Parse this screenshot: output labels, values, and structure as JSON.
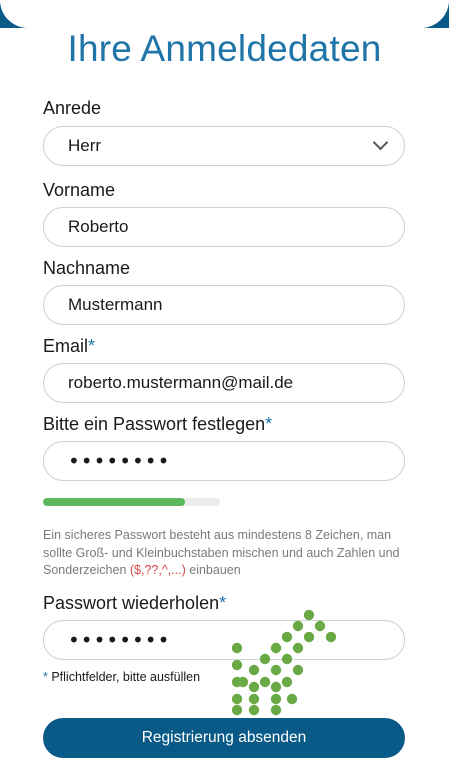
{
  "title": "Ihre Anmeldedaten",
  "salutation": {
    "label": "Anrede",
    "value": "Herr"
  },
  "first_name": {
    "label": "Vorname",
    "value": "Roberto"
  },
  "last_name": {
    "label": "Nachname",
    "value": "Mustermann"
  },
  "email": {
    "label": "Email",
    "required_mark": "*",
    "value": "roberto.mustermann@mail.de"
  },
  "password": {
    "label": "Bitte ein Passwort festlegen",
    "required_mark": "*",
    "value": "••••••••"
  },
  "password_strength": {
    "percent": 80,
    "color": "#5cb85c"
  },
  "hint": {
    "text_before": "Ein sicheres Passwort besteht aus mindestens 8 Zeichen, man sollte Groß- und Kleinbuchstaben mischen und auch Zahlen und Sonderzeichen ",
    "special_chars": "($,??,^,...)",
    "text_after": " einbauen"
  },
  "password_repeat": {
    "label": "Passwort wiederholen",
    "required_mark": "*",
    "value": "••••••••"
  },
  "mandatory_note": {
    "star": "*",
    "text": " Pflichtfelder, bitte ausfüllen"
  },
  "submit_label": "Registrierung absenden",
  "colors": {
    "accent": "#1f74a8",
    "button": "#0a5a87",
    "loading_dots": "#6aaa46"
  },
  "loading_indicator": {
    "icon": "loading-dots-arrow-icon"
  }
}
